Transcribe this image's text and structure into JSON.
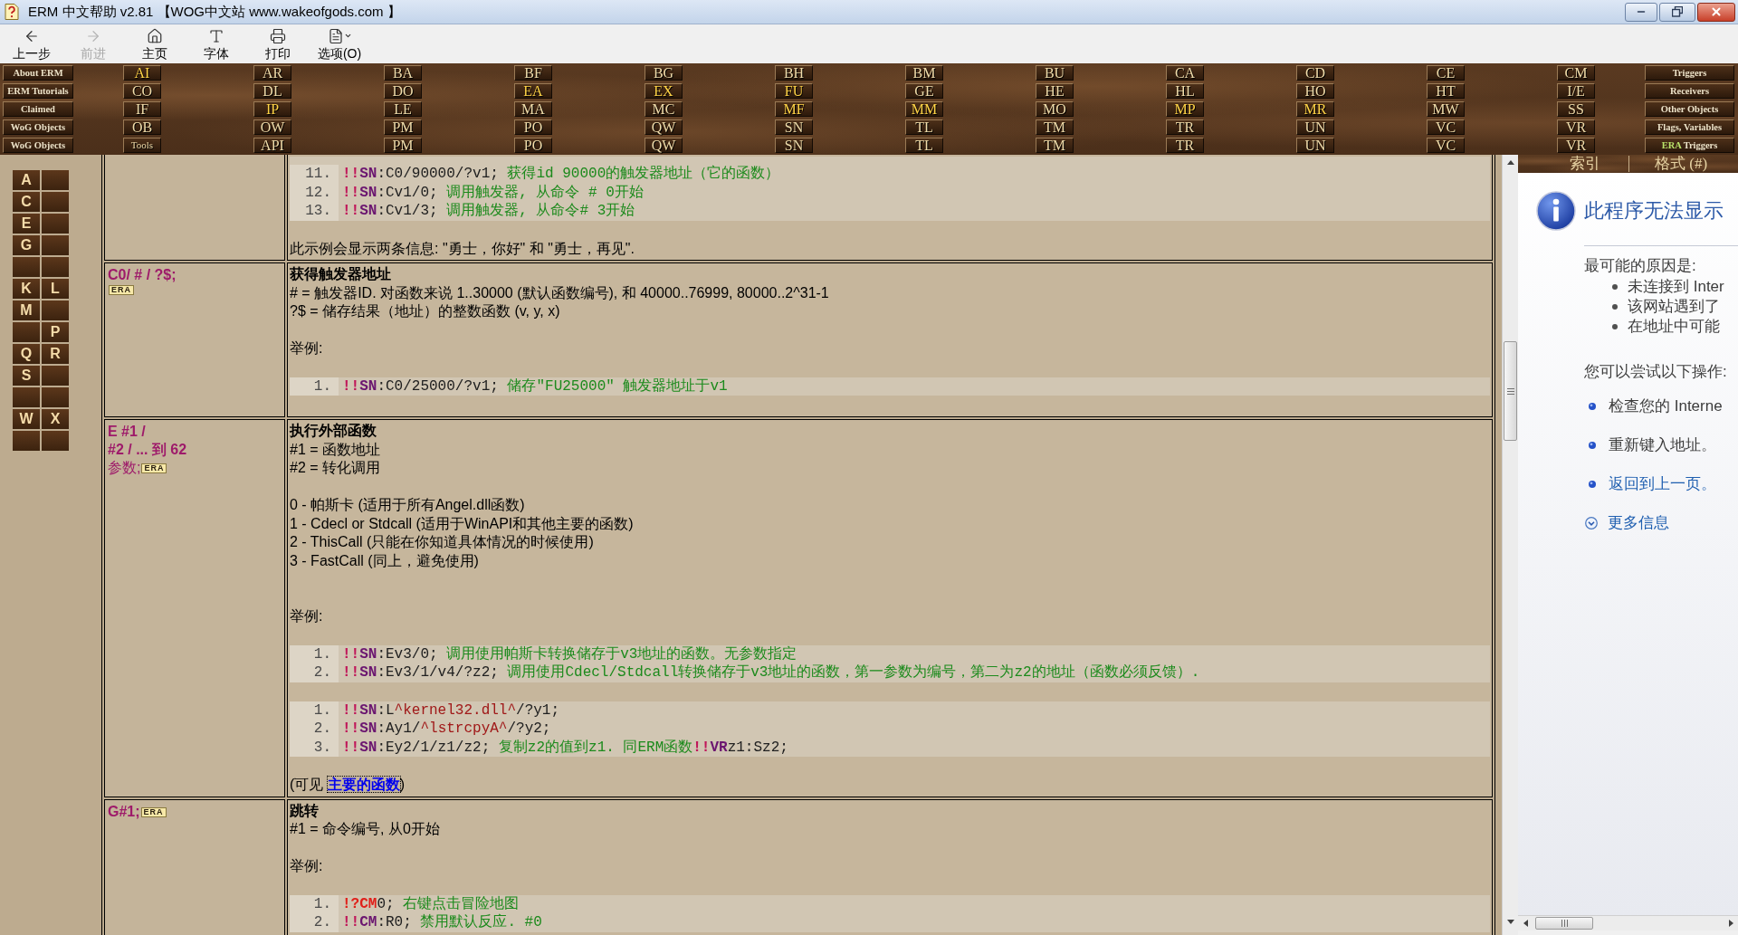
{
  "window": {
    "title": "ERM 中文帮助 v2.81 【WOG中文站 www.wakeofgods.com 】"
  },
  "toolbar": [
    {
      "kind": "back",
      "label": "上一步",
      "disabled": false
    },
    {
      "kind": "forward",
      "label": "前进",
      "disabled": true
    },
    {
      "kind": "home",
      "label": "主页",
      "disabled": false
    },
    {
      "kind": "font",
      "label": "字体",
      "disabled": false
    },
    {
      "kind": "print",
      "label": "打印",
      "disabled": false
    },
    {
      "kind": "options",
      "label": "选项(O)",
      "disabled": false
    }
  ],
  "nav": {
    "sections": [
      "About ERM",
      "ERM Tutorials",
      "Claimed",
      "WoG Objects",
      "WoG Objects"
    ],
    "columns": [
      [
        {
          "label": "AI",
          "kind": "code",
          "highlighted": true
        },
        {
          "label": "CO",
          "kind": "code",
          "highlighted": false
        },
        {
          "label": "IF",
          "kind": "code",
          "highlighted": false
        },
        {
          "label": "OB",
          "kind": "code",
          "highlighted": false
        },
        {
          "label": "Tools",
          "kind": "word",
          "highlighted": false
        }
      ],
      [
        {
          "label": "AR",
          "kind": "code",
          "highlighted": false
        },
        {
          "label": "DL",
          "kind": "code",
          "highlighted": false
        },
        {
          "label": "IP",
          "kind": "code",
          "highlighted": true
        },
        {
          "label": "OW",
          "kind": "code",
          "highlighted": false
        },
        {
          "label": "API",
          "kind": "code",
          "highlighted": false
        }
      ],
      [
        {
          "label": "BA",
          "kind": "code",
          "highlighted": false
        },
        {
          "label": "DO",
          "kind": "code",
          "highlighted": false
        },
        {
          "label": "LE",
          "kind": "code",
          "highlighted": false
        },
        {
          "label": "PM",
          "kind": "code",
          "highlighted": false
        },
        {
          "label": "PM",
          "kind": "code",
          "highlighted": false
        }
      ],
      [
        {
          "label": "BF",
          "kind": "code",
          "highlighted": false
        },
        {
          "label": "EA",
          "kind": "code",
          "highlighted": true
        },
        {
          "label": "MA",
          "kind": "code",
          "highlighted": false
        },
        {
          "label": "PO",
          "kind": "code",
          "highlighted": false
        },
        {
          "label": "PO",
          "kind": "code",
          "highlighted": false
        }
      ],
      [
        {
          "label": "BG",
          "kind": "code",
          "highlighted": false
        },
        {
          "label": "EX",
          "kind": "code",
          "highlighted": true
        },
        {
          "label": "MC",
          "kind": "code",
          "highlighted": false
        },
        {
          "label": "QW",
          "kind": "code",
          "highlighted": false
        },
        {
          "label": "QW",
          "kind": "code",
          "highlighted": false
        }
      ],
      [
        {
          "label": "BH",
          "kind": "code",
          "highlighted": false
        },
        {
          "label": "FU",
          "kind": "code",
          "highlighted": true
        },
        {
          "label": "MF",
          "kind": "code",
          "highlighted": true
        },
        {
          "label": "SN",
          "kind": "code",
          "highlighted": false
        },
        {
          "label": "SN",
          "kind": "code",
          "highlighted": false
        }
      ],
      [
        {
          "label": "BM",
          "kind": "code",
          "highlighted": false
        },
        {
          "label": "GE",
          "kind": "code",
          "highlighted": false
        },
        {
          "label": "MM",
          "kind": "code",
          "highlighted": true
        },
        {
          "label": "TL",
          "kind": "code",
          "highlighted": false
        },
        {
          "label": "TL",
          "kind": "code",
          "highlighted": false
        }
      ],
      [
        {
          "label": "BU",
          "kind": "code",
          "highlighted": false
        },
        {
          "label": "HE",
          "kind": "code",
          "highlighted": false
        },
        {
          "label": "MO",
          "kind": "code",
          "highlighted": false
        },
        {
          "label": "TM",
          "kind": "code",
          "highlighted": false
        },
        {
          "label": "TM",
          "kind": "code",
          "highlighted": false
        }
      ],
      [
        {
          "label": "CA",
          "kind": "code",
          "highlighted": false
        },
        {
          "label": "HL",
          "kind": "code",
          "highlighted": false
        },
        {
          "label": "MP",
          "kind": "code",
          "highlighted": true
        },
        {
          "label": "TR",
          "kind": "code",
          "highlighted": false
        },
        {
          "label": "TR",
          "kind": "code",
          "highlighted": false
        }
      ],
      [
        {
          "label": "CD",
          "kind": "code",
          "highlighted": false
        },
        {
          "label": "HO",
          "kind": "code",
          "highlighted": false
        },
        {
          "label": "MR",
          "kind": "code",
          "highlighted": true
        },
        {
          "label": "UN",
          "kind": "code",
          "highlighted": false
        },
        {
          "label": "UN",
          "kind": "code",
          "highlighted": false
        }
      ],
      [
        {
          "label": "CE",
          "kind": "code",
          "highlighted": false
        },
        {
          "label": "HT",
          "kind": "code",
          "highlighted": false
        },
        {
          "label": "MW",
          "kind": "code",
          "highlighted": false
        },
        {
          "label": "VC",
          "kind": "code",
          "highlighted": false
        },
        {
          "label": "VC",
          "kind": "code",
          "highlighted": false
        }
      ],
      [
        {
          "label": "CM",
          "kind": "code",
          "highlighted": false
        },
        {
          "label": "I/E",
          "kind": "code",
          "highlighted": false
        },
        {
          "label": "SS",
          "kind": "code",
          "highlighted": false
        },
        {
          "label": "VR",
          "kind": "code",
          "highlighted": false
        },
        {
          "label": "VR",
          "kind": "code",
          "highlighted": false
        }
      ]
    ],
    "topics": [
      {
        "label": "Triggers"
      },
      {
        "label": "Receivers"
      },
      {
        "label": "Other Objects"
      },
      {
        "label": "Flags, Variables"
      },
      {
        "tag": "ERA",
        "label": "Triggers"
      }
    ]
  },
  "letter_index": [
    {
      "kind": "letter",
      "text": "A"
    },
    {
      "kind": "blank"
    },
    {
      "kind": "letter",
      "text": "C"
    },
    {
      "kind": "blank"
    },
    {
      "kind": "letter",
      "text": "E"
    },
    {
      "kind": "blank"
    },
    {
      "kind": "letter",
      "text": "G"
    },
    {
      "kind": "blank"
    },
    {
      "kind": "blank"
    },
    {
      "kind": "blank"
    },
    {
      "kind": "letter",
      "text": "K"
    },
    {
      "kind": "letter",
      "text": "L"
    },
    {
      "kind": "letter",
      "text": "M"
    },
    {
      "kind": "blank"
    },
    {
      "kind": "blank"
    },
    {
      "kind": "letter",
      "text": "P"
    },
    {
      "kind": "letter",
      "text": "Q"
    },
    {
      "kind": "letter",
      "text": "R"
    },
    {
      "kind": "letter",
      "text": "S"
    },
    {
      "kind": "blank"
    },
    {
      "kind": "blank"
    },
    {
      "kind": "blank"
    },
    {
      "kind": "letter",
      "text": "W"
    },
    {
      "kind": "letter",
      "text": "X"
    },
    {
      "kind": "blank"
    },
    {
      "kind": "blank"
    }
  ],
  "table": {
    "rows": [
      {
        "content": [
          {
            "kind": "code",
            "lines": [
              {
                "number": "11.",
                "parts": [
                  {
                    "kind": "bang",
                    "text": "!!"
                  },
                  {
                    "kind": "command",
                    "text": "SN"
                  },
                  {
                    "kind": "plain",
                    "text": ":C0/90000/?v1;"
                  },
                  {
                    "kind": "comment",
                    "text": " 获得id 90000的触发器地址（它的函数）"
                  }
                ]
              },
              {
                "number": "12.",
                "parts": [
                  {
                    "kind": "bang",
                    "text": "!!"
                  },
                  {
                    "kind": "command",
                    "text": "SN"
                  },
                  {
                    "kind": "plain",
                    "text": ":Cv1/0;"
                  },
                  {
                    "kind": "comment",
                    "text": " 调用触发器, 从命令 # 0开始"
                  }
                ]
              },
              {
                "number": "13.",
                "parts": [
                  {
                    "kind": "bang",
                    "text": "!!"
                  },
                  {
                    "kind": "command",
                    "text": "SN"
                  },
                  {
                    "kind": "plain",
                    "text": ":Cv1/3;"
                  },
                  {
                    "kind": "comment",
                    "text": " 调用触发器, 从命令# 3开始"
                  }
                ]
              }
            ]
          },
          {
            "kind": "text",
            "text": "此示例会显示两条信息: \"勇士，你好\" 和 \"勇士，再见\"."
          }
        ]
      },
      {
        "syntax": [
          {
            "text": "C0/ # / ?$;",
            "bold": true
          },
          {
            "badge": "ERA"
          }
        ],
        "content": [
          {
            "kind": "heading",
            "text": "获得触发器地址"
          },
          {
            "kind": "text",
            "text": "# = 触发器ID. 对函数来说 1..30000 (默认函数编号), 和 40000..76999, 80000..2^31-1"
          },
          {
            "kind": "text",
            "text": "?$ = 储存结果（地址）的整数函数 (v, y, x)"
          },
          {
            "kind": "blank"
          },
          {
            "kind": "label",
            "text": "举例:"
          },
          {
            "kind": "code",
            "lines": [
              {
                "number": "1.",
                "parts": [
                  {
                    "kind": "bang",
                    "text": "!!"
                  },
                  {
                    "kind": "command",
                    "text": "SN"
                  },
                  {
                    "kind": "plain",
                    "text": ":C0/25000/?v1;"
                  },
                  {
                    "kind": "comment",
                    "text": " 储存\"FU25000\" 触发器地址于v1"
                  }
                ]
              }
            ]
          }
        ]
      },
      {
        "syntax": [
          {
            "text": "E #1 /",
            "bold": true
          },
          {
            "text": "#2 / ... 到 62",
            "bold": true
          },
          {
            "text": "参数;",
            "bold": false,
            "badge": "ERA"
          }
        ],
        "content": [
          {
            "kind": "heading",
            "text": "执行外部函数"
          },
          {
            "kind": "text",
            "text": "#1 = 函数地址"
          },
          {
            "kind": "text",
            "text": "#2 = 转化调用"
          },
          {
            "kind": "blank"
          },
          {
            "kind": "text",
            "text": "0 - 帕斯卡 (适用于所有Angel.dll函数)"
          },
          {
            "kind": "text",
            "text": "1 - Cdecl or Stdcall (适用于WinAPI和其他主要的函数)"
          },
          {
            "kind": "text",
            "text": "2 - ThisCall (只能在你知道具体情况的时候使用)"
          },
          {
            "kind": "text",
            "text": "3 - FastCall (同上，避免使用)"
          },
          {
            "kind": "blank"
          },
          {
            "kind": "blank"
          },
          {
            "kind": "label",
            "text": "举例:"
          },
          {
            "kind": "code",
            "lines": [
              {
                "number": "1.",
                "parts": [
                  {
                    "kind": "bang",
                    "text": "!!"
                  },
                  {
                    "kind": "command",
                    "text": "SN"
                  },
                  {
                    "kind": "plain",
                    "text": ":Ev3/0;"
                  },
                  {
                    "kind": "comment",
                    "text": " 调用使用帕斯卡转换储存于v3地址的函数。无参数指定"
                  }
                ]
              },
              {
                "number": "2.",
                "parts": [
                  {
                    "kind": "bang",
                    "text": "!!"
                  },
                  {
                    "kind": "command",
                    "text": "SN"
                  },
                  {
                    "kind": "plain",
                    "text": ":Ev3/1/v4/?z2;"
                  },
                  {
                    "kind": "comment",
                    "text": " 调用使用Cdecl/Stdcall转换储存于v3地址的函数，第一参数为编号，第二为z2的地址（函数必须反馈）."
                  }
                ]
              }
            ]
          },
          {
            "kind": "code",
            "lines": [
              {
                "number": "1.",
                "parts": [
                  {
                    "kind": "bang",
                    "text": "!!"
                  },
                  {
                    "kind": "command",
                    "text": "SN"
                  },
                  {
                    "kind": "plain",
                    "text": ":L"
                  },
                  {
                    "kind": "string",
                    "text": "^kernel32.dll^"
                  },
                  {
                    "kind": "plain",
                    "text": "/?y1;"
                  }
                ]
              },
              {
                "number": "2.",
                "parts": [
                  {
                    "kind": "bang",
                    "text": "!!"
                  },
                  {
                    "kind": "command",
                    "text": "SN"
                  },
                  {
                    "kind": "plain",
                    "text": ":Ay1/"
                  },
                  {
                    "kind": "string",
                    "text": "^lstrcpyA^"
                  },
                  {
                    "kind": "plain",
                    "text": "/?y2;"
                  }
                ]
              },
              {
                "number": "3.",
                "parts": [
                  {
                    "kind": "bang",
                    "text": "!!"
                  },
                  {
                    "kind": "command",
                    "text": "SN"
                  },
                  {
                    "kind": "plain",
                    "text": ":Ey2/1/z1/z2;"
                  },
                  {
                    "kind": "comment",
                    "text": " 复制z2的值到z1. 同ERM函数"
                  },
                  {
                    "kind": "bang",
                    "text": "!!"
                  },
                  {
                    "kind": "command",
                    "text": "VR"
                  },
                  {
                    "kind": "plain",
                    "text": "z1:Sz2;"
                  }
                ]
              }
            ]
          },
          {
            "kind": "note",
            "before": "(可见 ",
            "link": {
              "text": "主要的函数",
              "focused": true
            },
            "after": ")"
          }
        ]
      },
      {
        "syntax": [
          {
            "text": "G#1;",
            "bold": true,
            "badge": "ERA"
          }
        ],
        "content": [
          {
            "kind": "heading",
            "text": "跳转"
          },
          {
            "kind": "text",
            "text": "#1 = 命令编号, 从0开始"
          },
          {
            "kind": "blank"
          },
          {
            "kind": "label",
            "text": "举例:"
          },
          {
            "kind": "code",
            "lines": [
              {
                "number": "1.",
                "parts": [
                  {
                    "kind": "trigger",
                    "text": "!?CM"
                  },
                  {
                    "kind": "plain",
                    "text": "0;"
                  },
                  {
                    "kind": "comment",
                    "text": " 右键点击冒险地图"
                  }
                ]
              },
              {
                "number": "2.",
                "parts": [
                  {
                    "kind": "bang",
                    "text": "!!"
                  },
                  {
                    "kind": "command",
                    "text": "CM"
                  },
                  {
                    "kind": "plain",
                    "text": ":R0;"
                  },
                  {
                    "kind": "comment",
                    "text": " 禁用默认反应. #0"
                  }
                ]
              }
            ]
          }
        ]
      }
    ]
  },
  "side_tabs": [
    {
      "label": "索引"
    },
    {
      "label": "格式 (#)"
    }
  ],
  "error_page": {
    "title": "此程序无法显示",
    "causes_heading": "最可能的原因是:",
    "causes": [
      "未连接到 Inter",
      "该网站遇到了",
      "在地址中可能"
    ],
    "actions_heading": "您可以尝试以下操作:",
    "actions": [
      {
        "kind": "text",
        "text": "检查您的 Interne"
      },
      {
        "kind": "text",
        "text": "重新键入地址。"
      },
      {
        "kind": "link",
        "text": "返回到上一页。"
      }
    ],
    "more": "更多信息"
  }
}
